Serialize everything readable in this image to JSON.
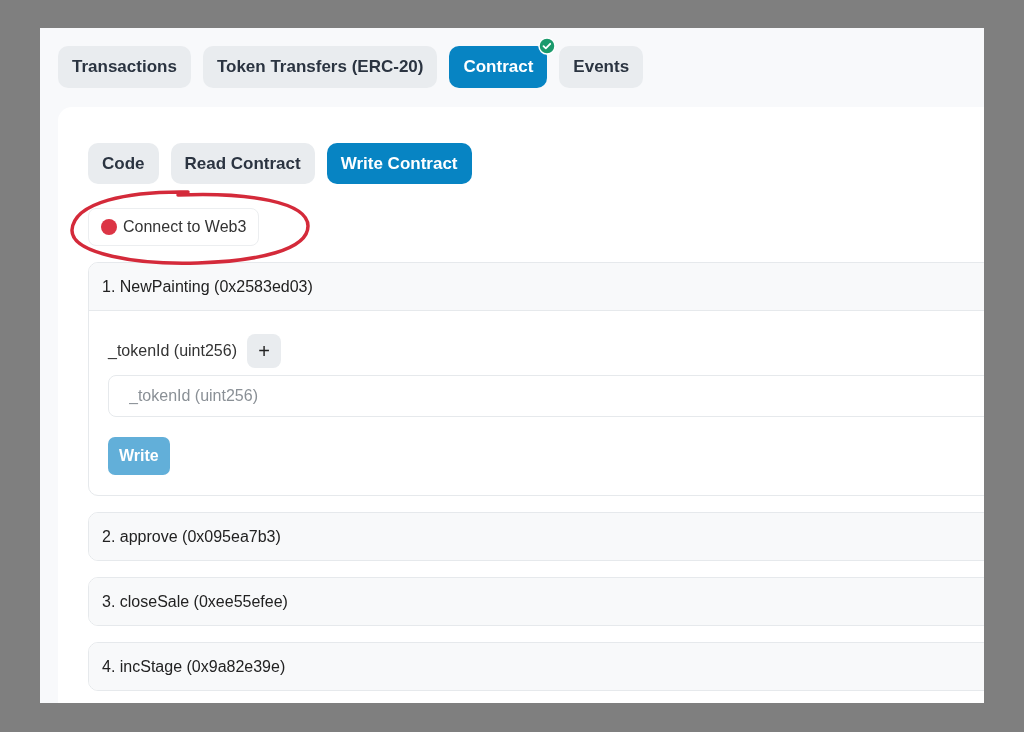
{
  "tabs": [
    {
      "label": "Transactions",
      "selected": false,
      "verified": false
    },
    {
      "label": "Token Transfers (ERC-20)",
      "selected": false,
      "verified": false
    },
    {
      "label": "Contract",
      "selected": true,
      "verified": true
    },
    {
      "label": "Events",
      "selected": false,
      "verified": false
    }
  ],
  "subtabs": [
    {
      "label": "Code",
      "selected": false
    },
    {
      "label": "Read Contract",
      "selected": false
    },
    {
      "label": "Write Contract",
      "selected": true
    }
  ],
  "connect_button": {
    "label": "Connect to Web3",
    "connected": false
  },
  "functions": [
    {
      "title": "1. NewPainting (0x2583ed03)",
      "expanded": true,
      "inputs": [
        {
          "label": "_tokenId (uint256)",
          "add_button": "+",
          "placeholder": "_tokenId (uint256)"
        }
      ],
      "button": {
        "label": "Write",
        "disabled": true
      }
    },
    {
      "title": "2. approve (0x095ea7b3)",
      "expanded": false
    },
    {
      "title": "3. closeSale (0xee55efee)",
      "expanded": false
    },
    {
      "title": "4. incStage (0x9a82e39e)",
      "expanded": false
    }
  ]
}
